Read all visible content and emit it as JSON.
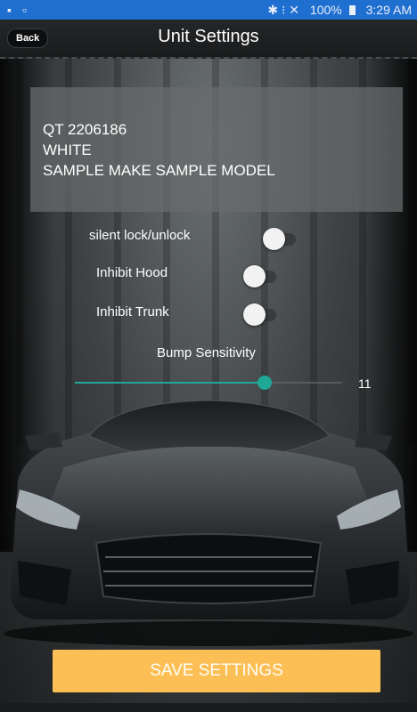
{
  "status_bar": {
    "left_icons": "▪ ▫",
    "signal": "✱ ⁝ ✕",
    "battery": "100%",
    "time": "3:29 AM"
  },
  "header": {
    "back_label": "Back",
    "title": "Unit Settings"
  },
  "vehicle": {
    "id": "QT 2206186",
    "color": "WHITE",
    "make_model": "SAMPLE MAKE  SAMPLE MODEL"
  },
  "toggles": [
    {
      "label": "silent lock/unlock",
      "on": false
    },
    {
      "label": "Inhibit Hood",
      "on": false
    },
    {
      "label": "Inhibit Trunk",
      "on": false
    }
  ],
  "slider": {
    "label": "Bump Sensitivity",
    "value": "11",
    "fraction": 0.71
  },
  "actions": {
    "save_label": "SAVE SETTINGS"
  },
  "colors": {
    "accent": "#1ea896",
    "save_button": "#fbbf55",
    "status_bar": "#1f6fd1"
  }
}
